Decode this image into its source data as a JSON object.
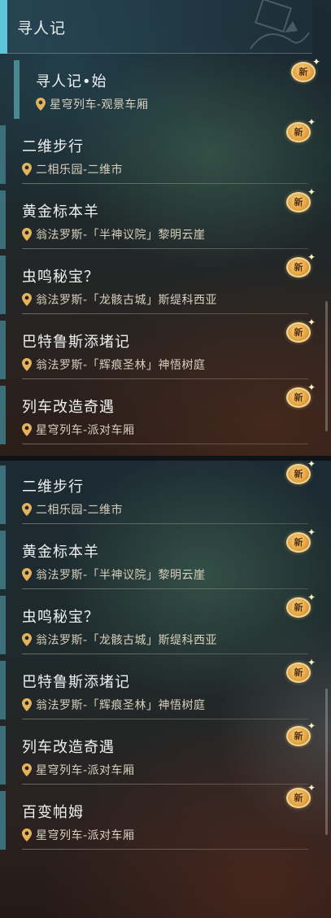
{
  "top_panel": {
    "header": {
      "title": "寻人记"
    },
    "selected": {
      "title": "寻人记•始",
      "location": "星穹列车-观景车厢"
    },
    "items": [
      {
        "title": "二维步行",
        "location": "二相乐园-二维市"
      },
      {
        "title": "黄金标本羊",
        "location": "翁法罗斯-「半神议院」黎明云崖"
      },
      {
        "title": "虫鸣秘宝？",
        "location": "翁法罗斯-「龙骸古城」斯缇科西亚"
      },
      {
        "title": "巴特鲁斯添堵记",
        "location": "翁法罗斯-「辉痕圣林」神悟树庭"
      },
      {
        "title": "列车改造奇遇",
        "location": "星穹列车-派对车厢"
      }
    ]
  },
  "bottom_panel": {
    "items": [
      {
        "title": "二维步行",
        "location": "二相乐园-二维市"
      },
      {
        "title": "黄金标本羊",
        "location": "翁法罗斯-「半神议院」黎明云崖"
      },
      {
        "title": "虫鸣秘宝？",
        "location": "翁法罗斯-「龙骸古城」斯缇科西亚"
      },
      {
        "title": "巴特鲁斯添堵记",
        "location": "翁法罗斯-「辉痕圣林」神悟树庭"
      },
      {
        "title": "列车改造奇遇",
        "location": "星穹列车-派对车厢"
      },
      {
        "title": "百变帕姆",
        "location": "星穹列车-派对车厢"
      }
    ]
  },
  "badge": {
    "text": "新",
    "icon": "new-badge-icon"
  },
  "icons": {
    "location": "location-pin-icon"
  },
  "colors": {
    "accent": "#5fc6da",
    "stripe": "#3b6f79",
    "badge_gold": "#e3a33f",
    "title_text": "#eef0f0",
    "location_text": "#d8d0bd"
  }
}
